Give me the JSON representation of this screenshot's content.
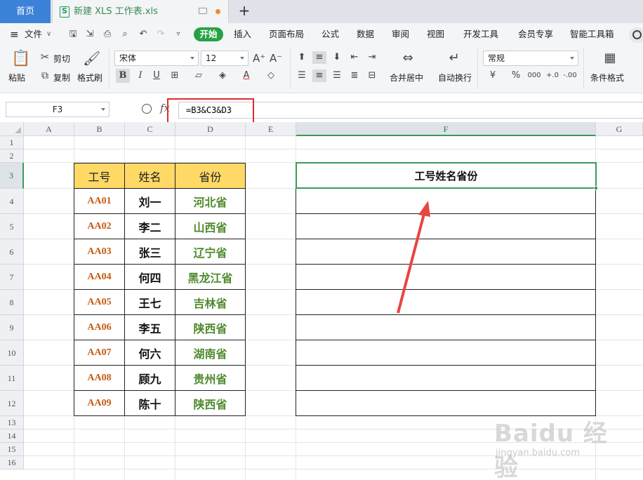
{
  "tabs": {
    "home": "首页",
    "file": "新建 XLS 工作表.xls",
    "add": "+"
  },
  "menu": {
    "file": "文件",
    "items": [
      "开始",
      "插入",
      "页面布局",
      "公式",
      "数据",
      "审阅",
      "视图",
      "开发工具",
      "会员专享",
      "智能工具箱"
    ]
  },
  "ribbon": {
    "paste": "粘贴",
    "cut": "剪切",
    "copy": "复制",
    "format_painter": "格式刷",
    "font": "宋体",
    "font_size": "12",
    "merge": "合并居中",
    "wrap": "自动换行",
    "number_format": "常规",
    "cond_format": "条件格式",
    "bold": "B",
    "italic": "I",
    "underline": "U",
    "font_color": "A",
    "currency": "¥",
    "percent": "%",
    "thousands": "000",
    "inc_decimal": "+.0",
    "dec_decimal": "-.00"
  },
  "formula_bar": {
    "cell_ref": "F3",
    "fx": "fx",
    "formula": "=B3&C3&D3"
  },
  "columns": [
    "A",
    "B",
    "C",
    "D",
    "E",
    "F",
    "G"
  ],
  "rows": [
    "1",
    "2",
    "3",
    "4",
    "5",
    "6",
    "7",
    "8",
    "9",
    "10",
    "11",
    "12",
    "13",
    "14",
    "15",
    "16"
  ],
  "table": {
    "headers": [
      "工号",
      "姓名",
      "省份"
    ],
    "rows": [
      [
        "AA01",
        "刘一",
        "河北省"
      ],
      [
        "AA02",
        "李二",
        "山西省"
      ],
      [
        "AA03",
        "张三",
        "辽宁省"
      ],
      [
        "AA04",
        "何四",
        "黑龙江省"
      ],
      [
        "AA05",
        "王七",
        "吉林省"
      ],
      [
        "AA06",
        "李五",
        "陕西省"
      ],
      [
        "AA07",
        "何六",
        "湖南省"
      ],
      [
        "AA08",
        "顾九",
        "贵州省"
      ],
      [
        "AA09",
        "陈十",
        "陕西省"
      ]
    ]
  },
  "result_header": "工号姓名省份",
  "watermark": {
    "logo": "Baidu 经验",
    "url": "jingyan.baidu.com"
  },
  "colors": {
    "accent_green": "#27a243",
    "header_fill": "#ffd966",
    "id_text": "#c45a11",
    "province_text": "#4e8a2e",
    "highlight_red": "#e02b2b"
  }
}
